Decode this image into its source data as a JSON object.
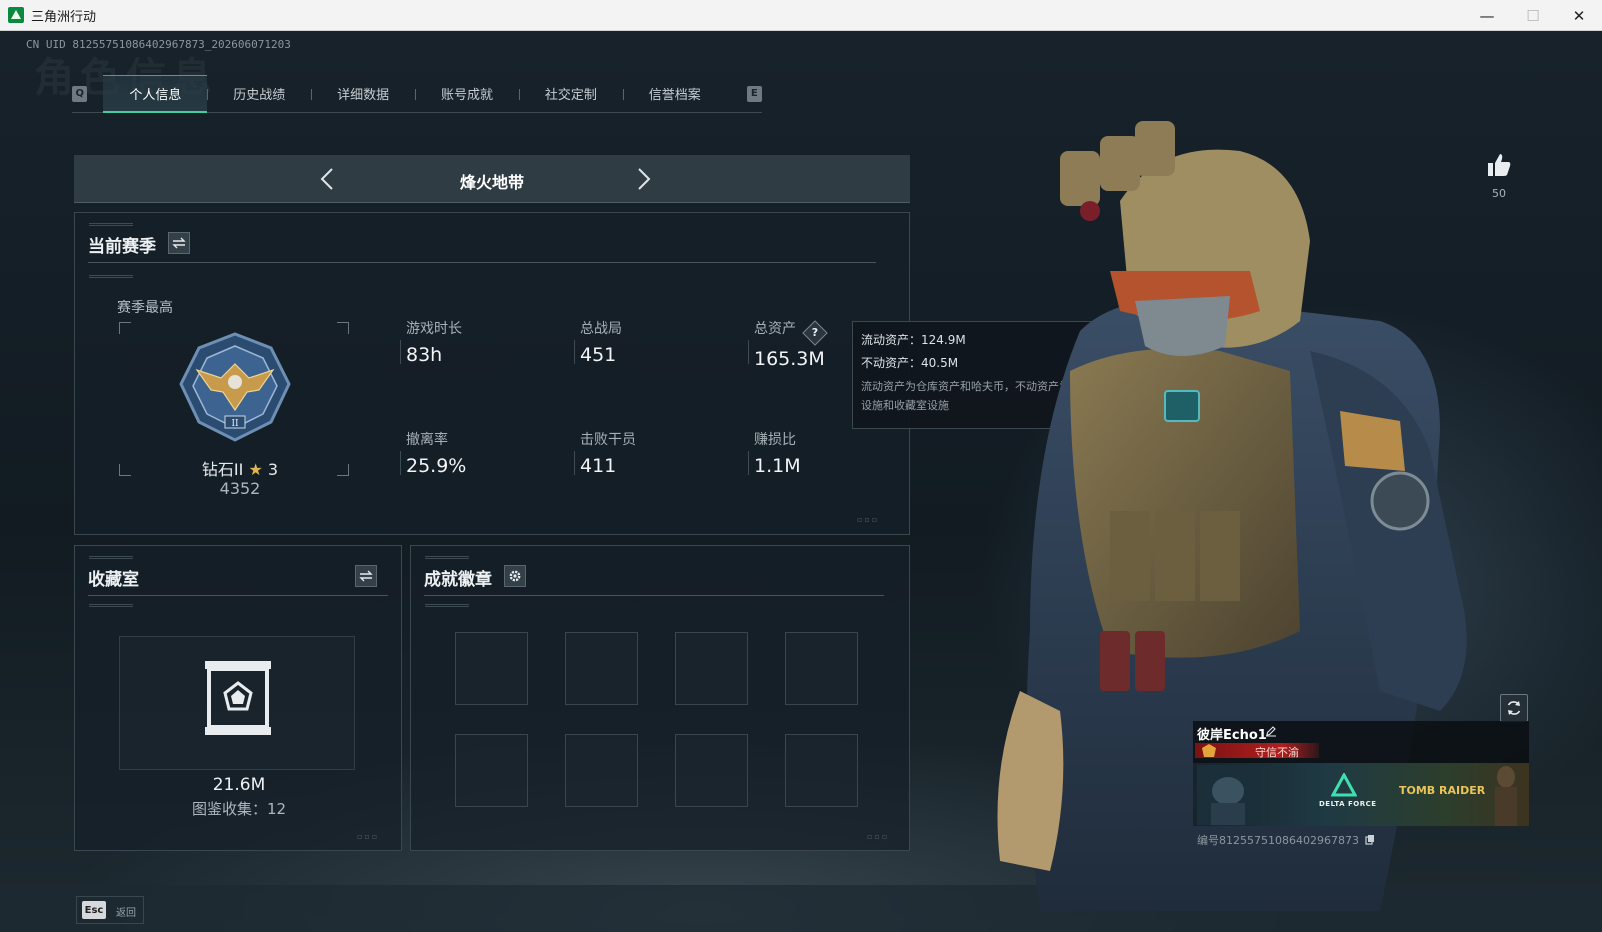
{
  "window": {
    "title": "三角洲行动",
    "controls": {
      "minimize": "—",
      "maximize": "☐",
      "close": "✕"
    }
  },
  "header": {
    "uid": "CN UID 81255751086402967873_202606071203",
    "watermark": "角色信息"
  },
  "tabs": {
    "left_key": "Q",
    "right_key": "E",
    "items": [
      {
        "label": "个人信息",
        "active": true
      },
      {
        "label": "历史战绩",
        "active": false
      },
      {
        "label": "详细数据",
        "active": false
      },
      {
        "label": "账号成就",
        "active": false
      },
      {
        "label": "社交定制",
        "active": false
      },
      {
        "label": "信誉档案",
        "active": false
      }
    ]
  },
  "mode": {
    "title": "烽火地带"
  },
  "season": {
    "title": "当前赛季",
    "best_label": "赛季最高",
    "rank_name": "钻石II",
    "rank_stars": "3",
    "rank_score": "4352",
    "stats": [
      {
        "label": "游戏时长",
        "value": "83h"
      },
      {
        "label": "总战局",
        "value": "451"
      },
      {
        "label": "总资产",
        "value": "165.3M"
      },
      {
        "label": "撤离率",
        "value": "25.9%"
      },
      {
        "label": "击败干员",
        "value": "411"
      },
      {
        "label": "赚损比",
        "value": "1.1M"
      }
    ]
  },
  "tooltip": {
    "liquid": "流动资产：124.9M",
    "fixed": "不动资产：40.5M",
    "desc": "流动资产为仓库资产和哈夫币，不动资产为特勤处设施和收藏室设施"
  },
  "collection": {
    "title": "收藏室",
    "value": "21.6M",
    "count": "图鉴收集：12"
  },
  "badges": {
    "title": "成就徽章"
  },
  "like": {
    "count": "50"
  },
  "card": {
    "name": "彼岸Echo1",
    "honor": "守信不渝",
    "banner_brand_1": "DELTA FORCE",
    "banner_brand_2": "TOMB RAIDER",
    "id": "编号81255751086402967873"
  },
  "footer": {
    "esc_key": "Esc",
    "esc_label": "返回"
  },
  "colors": {
    "accent": "#3fcfa0",
    "panel_bg": "#162028",
    "honor_red": "#b01f1f"
  }
}
